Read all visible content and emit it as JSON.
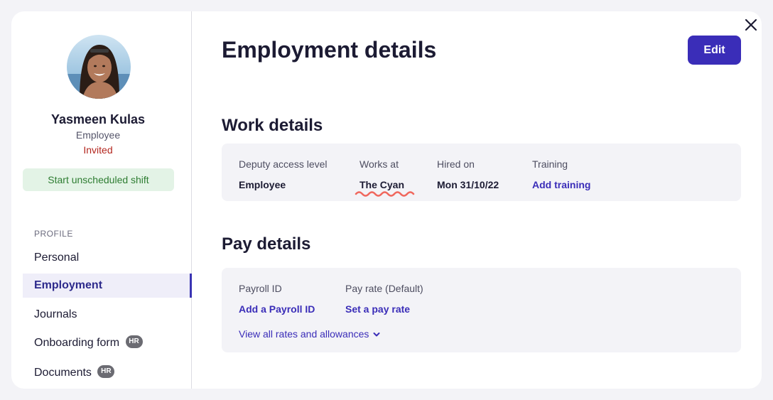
{
  "sidebar": {
    "user": {
      "name": "Yasmeen Kulas",
      "role": "Employee",
      "status": "Invited"
    },
    "start_shift_label": "Start unscheduled shift",
    "section_label": "PROFILE",
    "items": [
      {
        "label": "Personal",
        "active": false
      },
      {
        "label": "Employment",
        "active": true
      },
      {
        "label": "Journals",
        "active": false
      },
      {
        "label": "Onboarding form",
        "badge": "HR",
        "active": false
      },
      {
        "label": "Documents",
        "badge": "HR",
        "active": false
      }
    ]
  },
  "main": {
    "title": "Employment details",
    "edit_label": "Edit",
    "work": {
      "title": "Work details",
      "fields": [
        {
          "label": "Deputy access level",
          "value": "Employee"
        },
        {
          "label": "Works at",
          "value": "The Cyan"
        },
        {
          "label": "Hired on",
          "value": "Mon 31/10/22"
        },
        {
          "label": "Training",
          "value": "Add training"
        }
      ]
    },
    "pay": {
      "title": "Pay details",
      "fields": [
        {
          "label": "Payroll ID",
          "value": "Add a Payroll ID"
        },
        {
          "label": "Pay rate (Default)",
          "value": "Set a pay rate"
        }
      ],
      "rates_link": "View all rates and allowances"
    }
  },
  "icons": {
    "close": "close-icon",
    "chevron": "chevron-down-icon"
  },
  "colors": {
    "accent": "#3a2db8",
    "invited": "#b3261e",
    "shift_bg": "#e3f3e6",
    "shift_text": "#2e7d32",
    "squiggle": "#f0675d"
  }
}
